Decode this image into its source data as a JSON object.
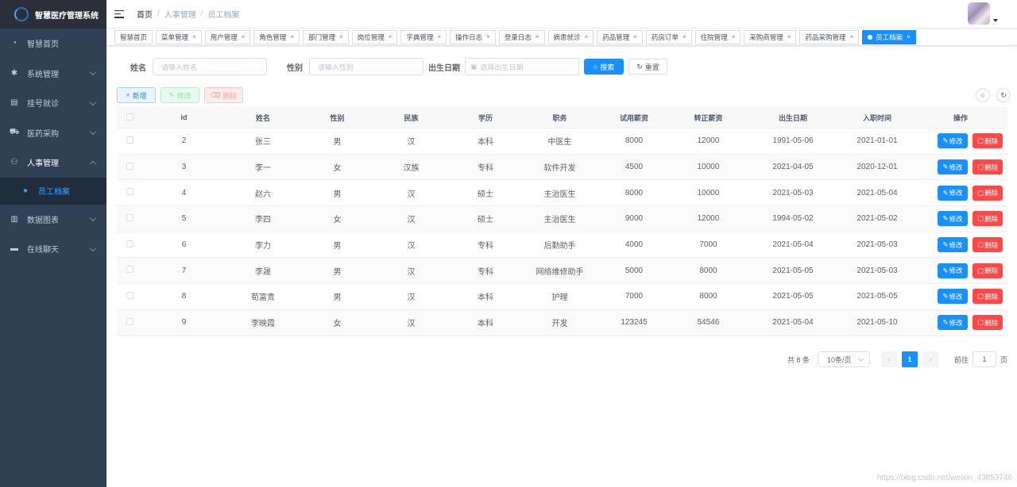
{
  "app": {
    "title": "智慧医疗管理系统"
  },
  "sidebar": {
    "items": [
      {
        "label": "智慧首页",
        "icon": "dashboard-icon",
        "glyph": "◔",
        "has_children": false
      },
      {
        "label": "系统管理",
        "icon": "gear-icon",
        "glyph": "✱",
        "has_children": true
      },
      {
        "label": "挂号就诊",
        "icon": "document-icon",
        "glyph": "▤",
        "has_children": true
      },
      {
        "label": "医药采购",
        "icon": "cart-icon",
        "glyph": "⛟",
        "has_children": true
      },
      {
        "label": "人事管理",
        "icon": "users-icon",
        "glyph": "⚇",
        "has_children": true,
        "open": true
      },
      {
        "label": "数据图表",
        "icon": "bar-chart-icon",
        "glyph": "▥",
        "has_children": true
      },
      {
        "label": "在线聊天",
        "icon": "chat-icon",
        "glyph": "▬",
        "has_children": true
      }
    ],
    "sub_item": {
      "label": "员工档案",
      "icon": "user-icon",
      "glyph": "●"
    }
  },
  "breadcrumb": [
    "首页",
    "人事管理",
    "员工档案"
  ],
  "tags": [
    {
      "label": "智慧首页",
      "closable": false,
      "active": false
    },
    {
      "label": "菜单管理",
      "closable": true,
      "active": false
    },
    {
      "label": "用户管理",
      "closable": true,
      "active": false
    },
    {
      "label": "角色管理",
      "closable": true,
      "active": false
    },
    {
      "label": "部门管理",
      "closable": true,
      "active": false
    },
    {
      "label": "岗位管理",
      "closable": true,
      "active": false
    },
    {
      "label": "字典管理",
      "closable": true,
      "active": false
    },
    {
      "label": "操作日志",
      "closable": true,
      "active": false
    },
    {
      "label": "登录日志",
      "closable": true,
      "active": false
    },
    {
      "label": "病患就诊",
      "closable": true,
      "active": false
    },
    {
      "label": "药品管理",
      "closable": true,
      "active": false
    },
    {
      "label": "药房订单",
      "closable": true,
      "active": false
    },
    {
      "label": "住院管理",
      "closable": true,
      "active": false
    },
    {
      "label": "采购商管理",
      "closable": true,
      "active": false
    },
    {
      "label": "药品采购管理",
      "closable": true,
      "active": false
    },
    {
      "label": "员工档案",
      "closable": true,
      "active": true
    }
  ],
  "search": {
    "name_label": "姓名",
    "name_placeholder": "请输入姓名",
    "gender_label": "性别",
    "gender_placeholder": "请输入性别",
    "birth_label": "出生日期",
    "birth_placeholder": "选择出生日期",
    "search_btn": "搜索",
    "reset_btn": "重置"
  },
  "toolbar": {
    "add": "新增",
    "edit": "修改",
    "delete": "删除"
  },
  "table": {
    "columns": [
      "id",
      "姓名",
      "性别",
      "民族",
      "学历",
      "职务",
      "试用薪资",
      "转正薪资",
      "出生日期",
      "入职时间",
      "操作"
    ],
    "rows": [
      [
        "2",
        "张三",
        "男",
        "汉",
        "本科",
        "中医生",
        "8000",
        "12000",
        "1991-05-06",
        "2021-01-01"
      ],
      [
        "3",
        "李一",
        "女",
        "汉族",
        "专科",
        "软件开发",
        "4500",
        "10000",
        "2021-04-05",
        "2020-12-01"
      ],
      [
        "4",
        "赵六",
        "男",
        "汉",
        "硕士",
        "主治医生",
        "8000",
        "10000",
        "2021-05-03",
        "2021-05-04"
      ],
      [
        "5",
        "李四",
        "女",
        "汉",
        "硕士",
        "主治医生",
        "9000",
        "12000",
        "1994-05-02",
        "2021-05-02"
      ],
      [
        "6",
        "李力",
        "男",
        "汉",
        "专科",
        "后勤助手",
        "4000",
        "7000",
        "2021-05-04",
        "2021-05-03"
      ],
      [
        "7",
        "李晟",
        "男",
        "汉",
        "专科",
        "网络维修助手",
        "5000",
        "8000",
        "2021-05-05",
        "2021-05-03"
      ],
      [
        "8",
        "荀富贵",
        "男",
        "汉",
        "本科",
        "护理",
        "7000",
        "8000",
        "2021-05-05",
        "2021-05-05"
      ],
      [
        "9",
        "李映霞",
        "女",
        "汉",
        "本科",
        "开发",
        "123245",
        "54546",
        "2021-05-04",
        "2021-05-10"
      ]
    ],
    "row_edit": "修改",
    "row_delete": "删除"
  },
  "pagination": {
    "total": "共 8 条",
    "page_size": "10条/页",
    "current_page": "1",
    "goto_label": "前往",
    "goto_value": "1",
    "page_unit": "页"
  },
  "watermark": "https://blog.csdn.net/weixin_43853746",
  "colors": {
    "accent": "#1890ff",
    "danger": "#ff4949",
    "sidebar": "#304156"
  }
}
